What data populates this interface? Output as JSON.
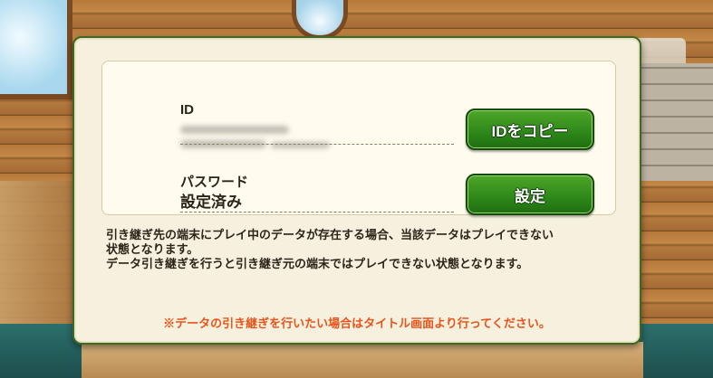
{
  "account": {
    "id_label": "ID",
    "password_label": "パスワード",
    "password_status": "設定済み"
  },
  "buttons": {
    "copy_id": "IDをコピー",
    "set_password": "設定"
  },
  "notice": {
    "line1": "引き継ぎ先の端末にプレイ中のデータが存在する場合、当該データはプレイできない",
    "line2": "状態となります。",
    "line3": "データ引き継ぎを行うと引き継ぎ元の端末ではプレイできない状態となります。"
  },
  "warning": "※データの引き継ぎを行いたい場合はタイトル画面より行ってください。",
  "colors": {
    "button_green": "#2f8a1a",
    "warning_orange": "#e8541b",
    "panel_bg": "#f6f1df"
  }
}
